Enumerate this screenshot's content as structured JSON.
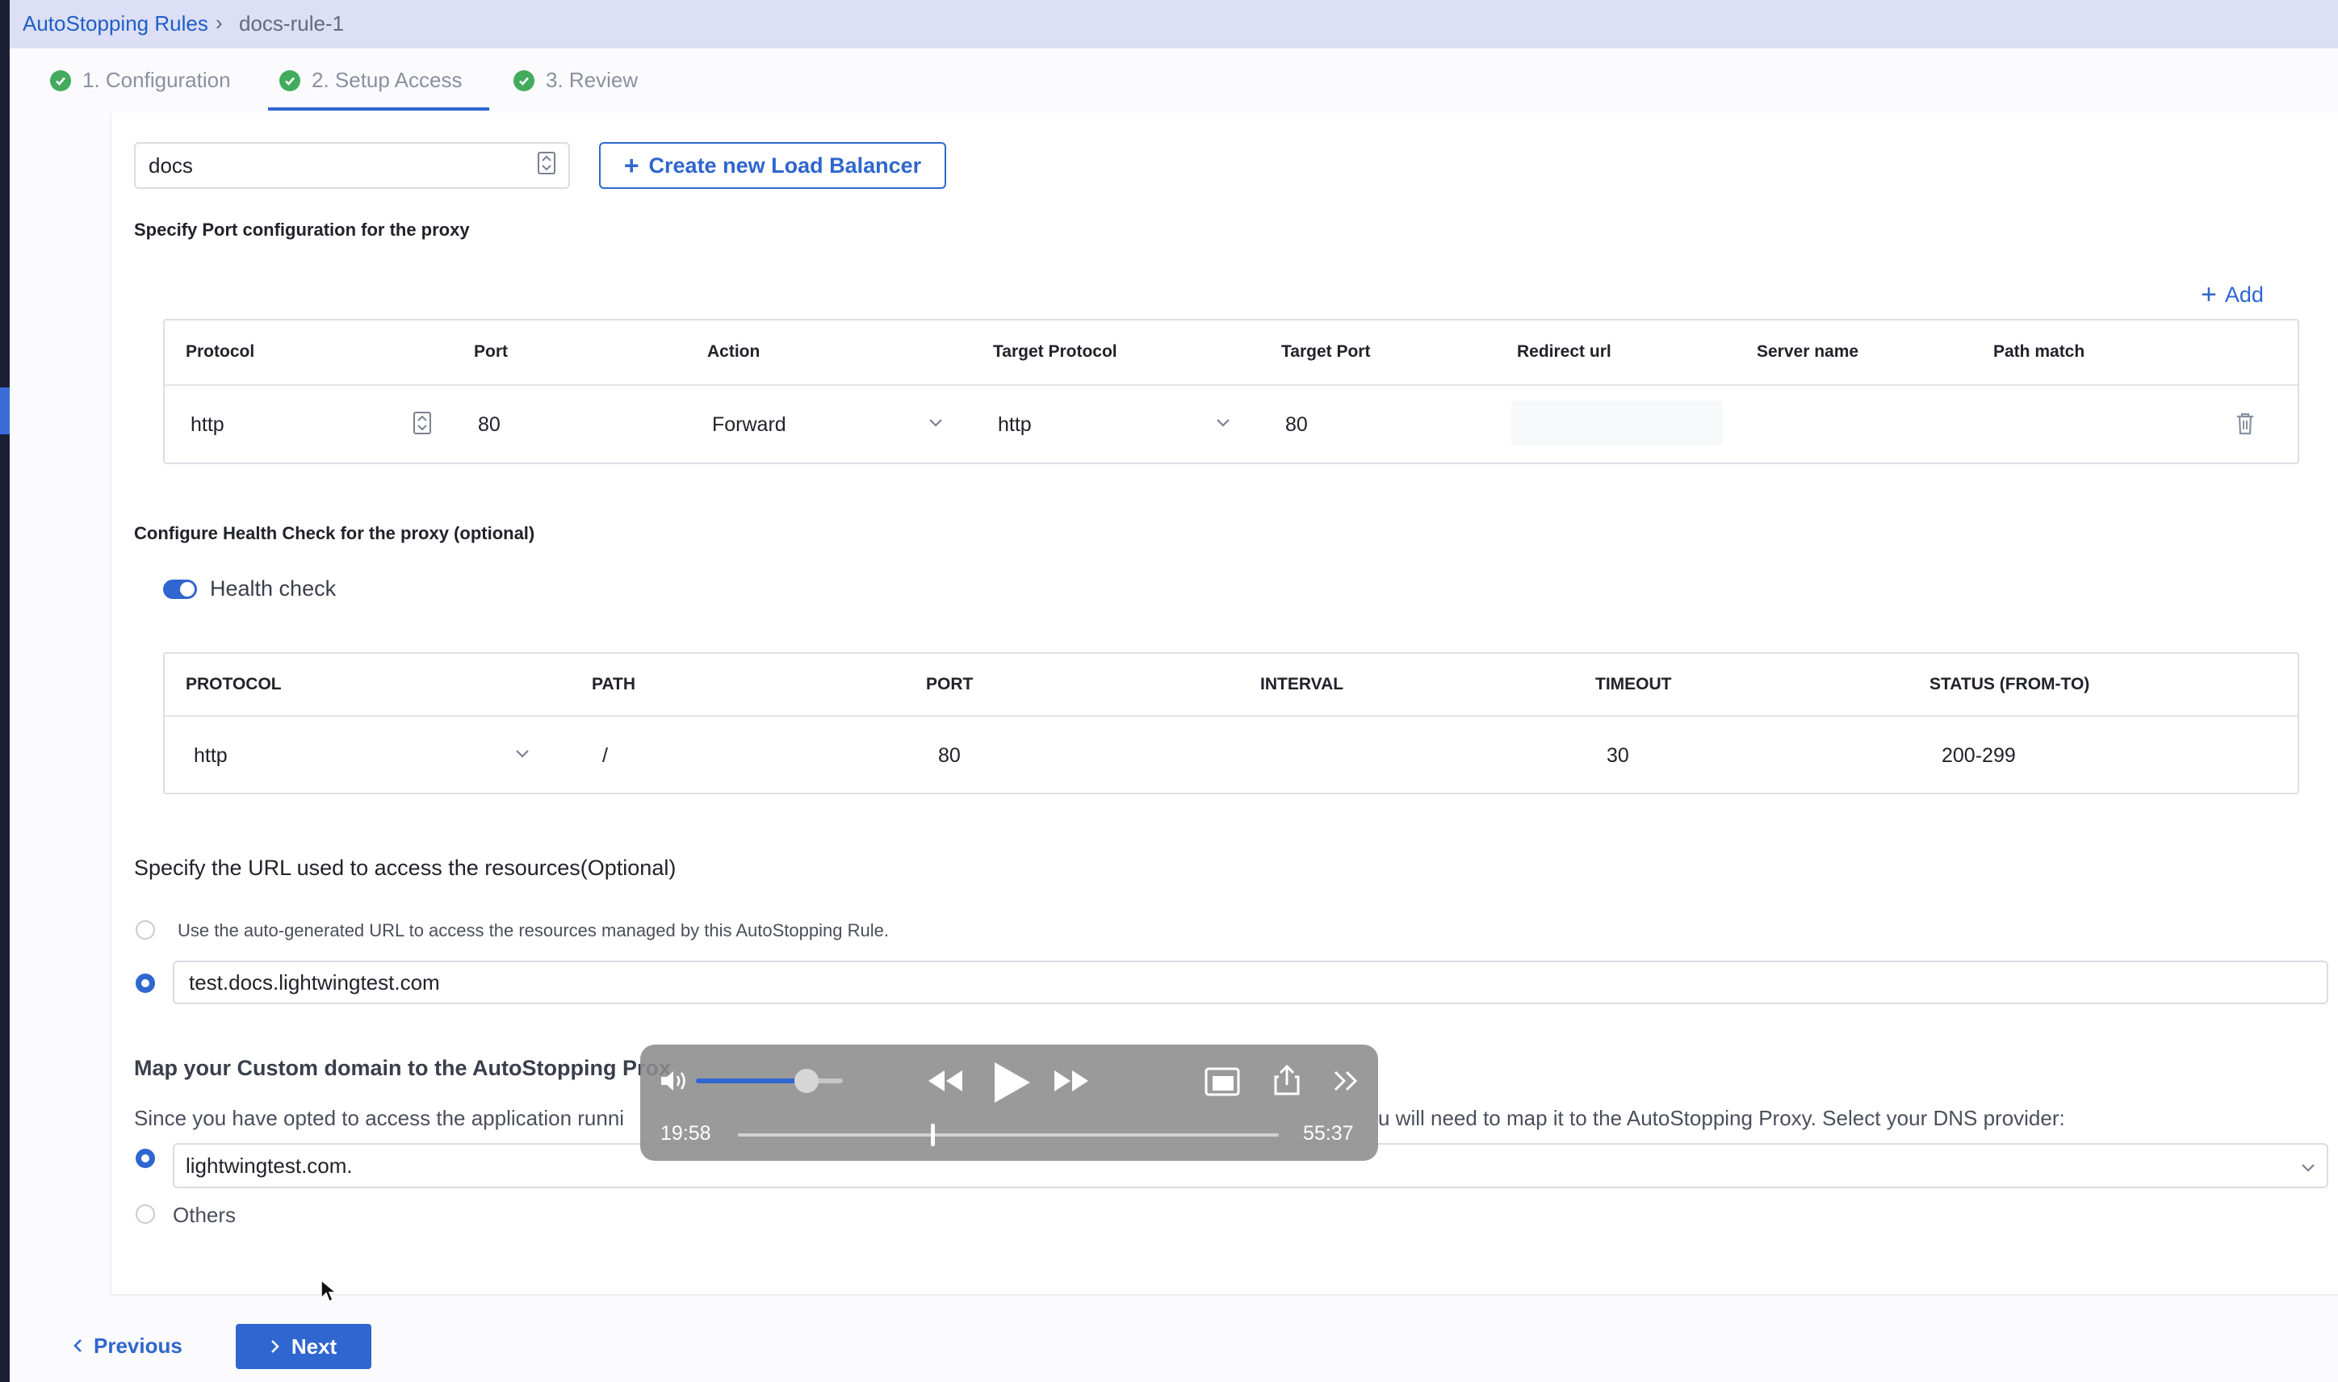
{
  "breadcrumb": {
    "parent": "AutoStopping Rules",
    "current": "docs-rule-1"
  },
  "steps": [
    {
      "label": "1. Configuration"
    },
    {
      "label": "2. Setup Access"
    },
    {
      "label": "3. Review"
    }
  ],
  "load_balancer": {
    "value": "docs",
    "create_label": "Create new Load Balancer"
  },
  "port_config": {
    "label": "Specify Port configuration for the proxy",
    "add_label": "Add",
    "headers": [
      "Protocol",
      "Port",
      "Action",
      "Target Protocol",
      "Target Port",
      "Redirect url",
      "Server name",
      "Path match"
    ],
    "rows": [
      {
        "protocol": "http",
        "port": "80",
        "action": "Forward",
        "target_protocol": "http",
        "target_port": "80"
      }
    ]
  },
  "health": {
    "label": "Configure Health Check for the proxy (optional)",
    "toggle_label": "Health check",
    "toggle_on": true,
    "headers": [
      "PROTOCOL",
      "PATH",
      "PORT",
      "INTERVAL",
      "TIMEOUT",
      "STATUS (FROM-TO)"
    ],
    "row": {
      "protocol": "http",
      "path": "/",
      "port": "80",
      "interval": "",
      "timeout": "30",
      "status": "200-299"
    }
  },
  "url_section": {
    "title": "Specify the URL used to access the resources(Optional)",
    "auto_option": "Use the auto-generated URL to access the resources managed by this AutoStopping Rule.",
    "custom_value": "test.docs.lightwingtest.com"
  },
  "custom_domain": {
    "title_visible": "Map your Custom domain to the AutoStopping Prox",
    "desc_left": "Since you have opted to access the application runni",
    "desc_right": "u will need to map it to the AutoStopping Proxy. Select your DNS provider:",
    "dns_value": "lightwingtest.com.",
    "others_label": "Others"
  },
  "footer": {
    "previous_label": "Previous",
    "next_label": "Next"
  },
  "video_overlay": {
    "elapsed": "19:58",
    "remaining": "55:37",
    "volume_level": 0.75,
    "progress": 0.36
  },
  "colors": {
    "primary": "#2f66cf",
    "success": "#42ab5d",
    "header_bg": "#dcdff5"
  }
}
